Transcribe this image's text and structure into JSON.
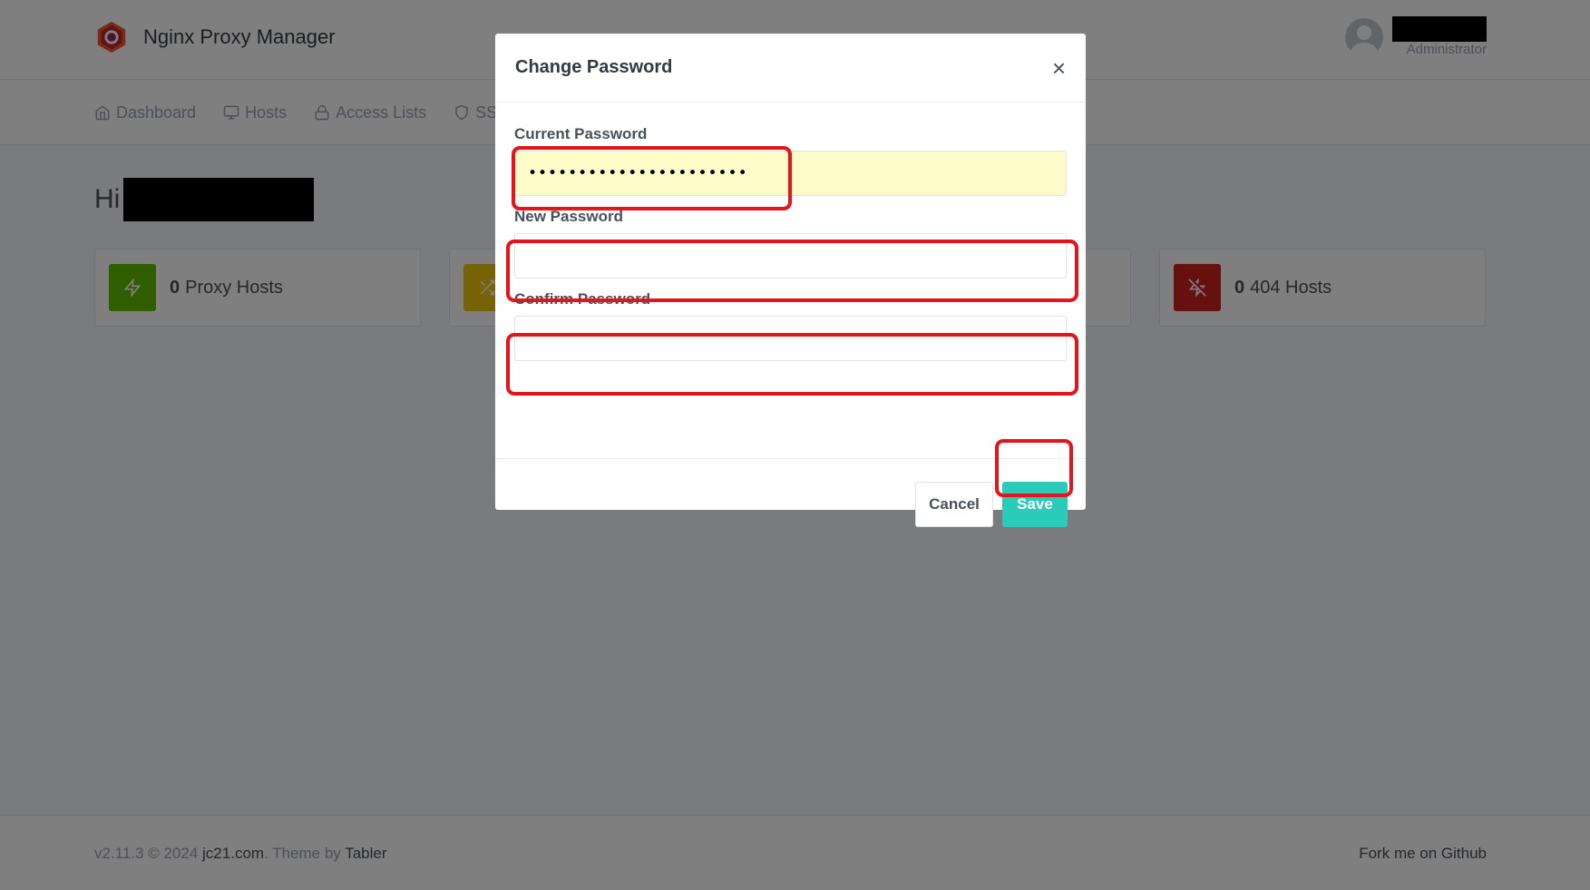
{
  "app": {
    "brand_name": "Nginx Proxy Manager",
    "user_role": "Administrator"
  },
  "nav": {
    "items": [
      {
        "label": "Dashboard",
        "icon": "home-icon"
      },
      {
        "label": "Hosts",
        "icon": "monitor-icon"
      },
      {
        "label": "Access Lists",
        "icon": "lock-icon"
      },
      {
        "label": "SSL",
        "icon": "shield-icon"
      }
    ]
  },
  "main": {
    "greeting": "Hi",
    "stats": [
      {
        "count": "0",
        "label": "Proxy Hosts",
        "color": "#5eba00",
        "icon": "zap-icon"
      },
      {
        "count": "",
        "label": "",
        "color": "#f1c40f",
        "icon": "shuffle-icon"
      },
      {
        "count": "0",
        "label": "404 Hosts",
        "color": "#cd201f",
        "icon": "zap-off-icon"
      }
    ]
  },
  "footer": {
    "version": "v2.11.3 © 2024 ",
    "link1": "jc21.com",
    "mid": ". Theme by ",
    "link2": "Tabler",
    "right": "Fork me on Github"
  },
  "modal": {
    "title": "Change Password",
    "close": "×",
    "current_label": "Current Password",
    "current_value": "••••••••••••••••••••••",
    "new_label": "New Password",
    "confirm_label": "Confirm Password",
    "cancel_label": "Cancel",
    "save_label": "Save"
  },
  "colors": {
    "accent": "#2bcbba",
    "highlight": "#e5131a",
    "autofill": "#fdfcc9"
  }
}
